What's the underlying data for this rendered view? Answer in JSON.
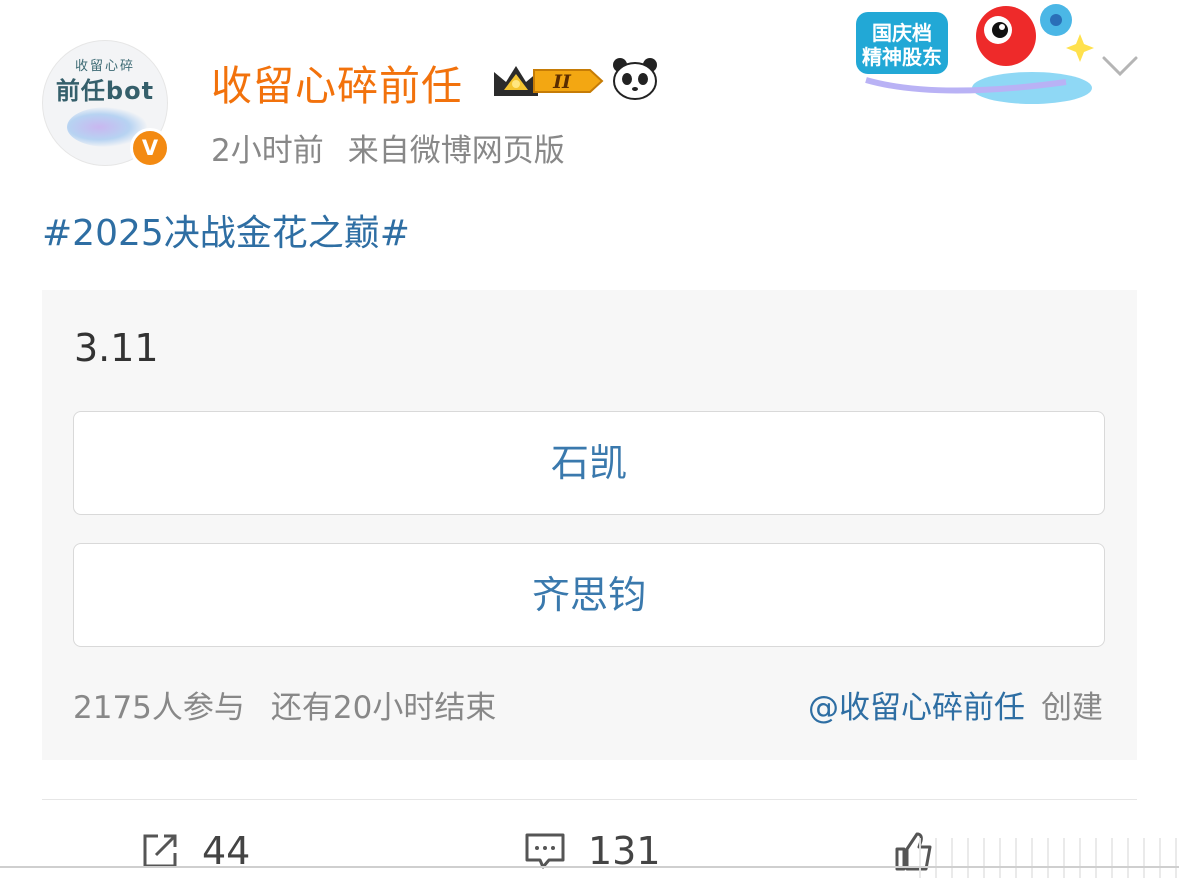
{
  "post": {
    "avatar": {
      "small_text": "收留心碎",
      "big_text": "前任bot"
    },
    "verified_badge": "V",
    "username": "收留心碎前任",
    "crown_level": "II",
    "time": "2小时前",
    "source": "来自微博网页版",
    "promo": {
      "line1": "国庆档",
      "line2": "精神股东"
    },
    "topic": "#2025决战金花之巅#"
  },
  "poll": {
    "title": "3.11",
    "options": [
      {
        "label": "石凯"
      },
      {
        "label": "齐思钧"
      }
    ],
    "participants": "2175人参与",
    "time_left": "还有20小时结束",
    "creator": "@收留心碎前任",
    "created_label": "创建"
  },
  "actions": {
    "forward_count": "44",
    "comment_count": "131"
  },
  "colors": {
    "username": "#f2720c",
    "link": "#2e6ea3",
    "meta": "#888888",
    "poll_bg": "#f7f7f7"
  }
}
